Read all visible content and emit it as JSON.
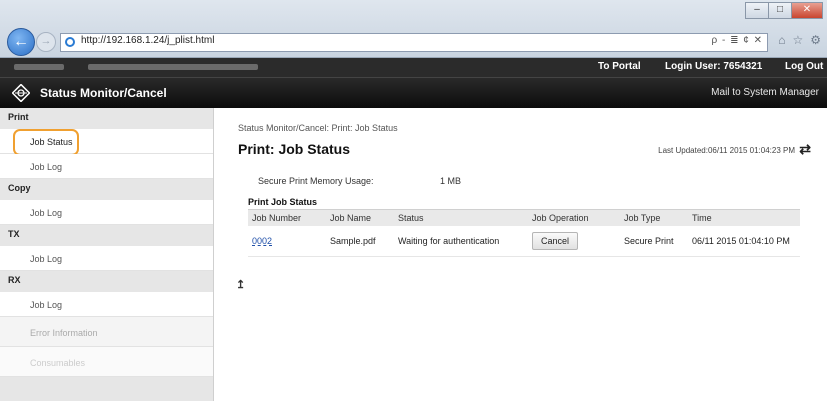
{
  "browser": {
    "url": "http://192.168.1.24/j_plist.html",
    "window_buttons": [
      "–",
      "□",
      "✕"
    ],
    "address_tools": "ρ ‑ ≣ ¢ ✕",
    "toolbar_icons": [
      "⌂",
      "☆",
      "⚙"
    ]
  },
  "header": {
    "to_portal": "To Portal",
    "login_user": "Login User:  7654321",
    "log_out": "Log Out",
    "app_title": "Status Monitor/Cancel",
    "mail_link": "Mail to System Manager"
  },
  "sidebar": {
    "sections": [
      {
        "category": "Print",
        "items": [
          "Job Status",
          "Job Log"
        ]
      },
      {
        "category": "Copy",
        "items": [
          "Job Log"
        ]
      },
      {
        "category": "TX",
        "items": [
          "Job Log"
        ]
      },
      {
        "category": "RX",
        "items": [
          "Job Log",
          "Error Information",
          "Consumables"
        ]
      }
    ]
  },
  "main": {
    "breadcrumb": "Status Monitor/Cancel: Print: Job Status",
    "title": "Print: Job Status",
    "last_updated": "Last Updated:06/11 2015 01:04:23 PM",
    "memory_label": "Secure Print Memory Usage:",
    "memory_value": "1 MB",
    "section_title": "Print Job Status",
    "table": {
      "headers": [
        "Job Number",
        "Job Name",
        "Status",
        "Job Operation",
        "Job Type",
        "Time"
      ],
      "rows": [
        {
          "job_number": "0002",
          "job_name": "Sample.pdf",
          "status": "Waiting for authentication",
          "operation": "Cancel",
          "job_type": "Secure Print",
          "time": "06/11 2015 01:04:10 PM"
        }
      ]
    }
  },
  "colors": {
    "header_bg": "#111111",
    "sidebar_bg": "#e6e6e6",
    "highlight": "#f0a030",
    "link": "#1f4fa8"
  }
}
